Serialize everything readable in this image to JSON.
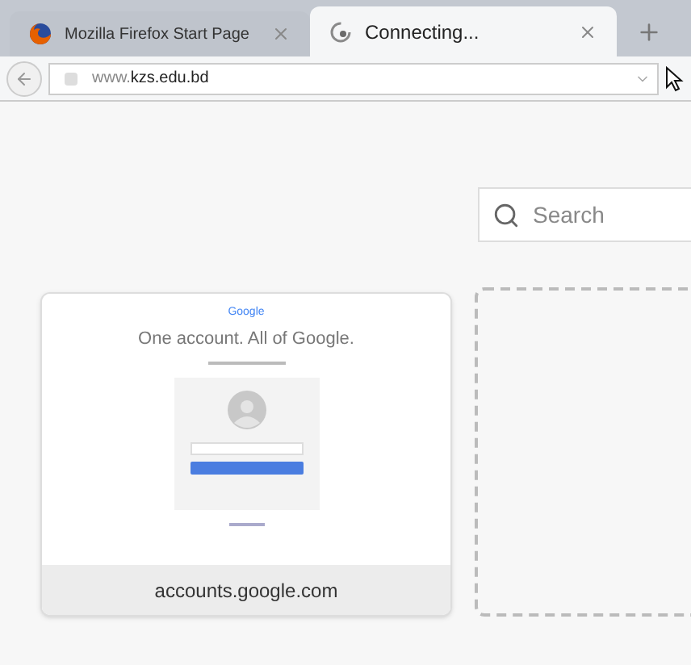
{
  "tabs": [
    {
      "title": "Mozilla Firefox Start Page",
      "kind": "firefox",
      "selected": false
    },
    {
      "title": "Connecting...",
      "kind": "loading",
      "selected": true
    }
  ],
  "address_bar": {
    "url_prefix": "www.",
    "url_domain": "kzs.edu.bd"
  },
  "search": {
    "placeholder": "Search"
  },
  "tiles": [
    {
      "kind": "thumbnail",
      "caption": "accounts.google.com",
      "thumbnail": {
        "logo": "Google",
        "headline": "One account. All of Google."
      }
    },
    {
      "kind": "empty"
    }
  ]
}
